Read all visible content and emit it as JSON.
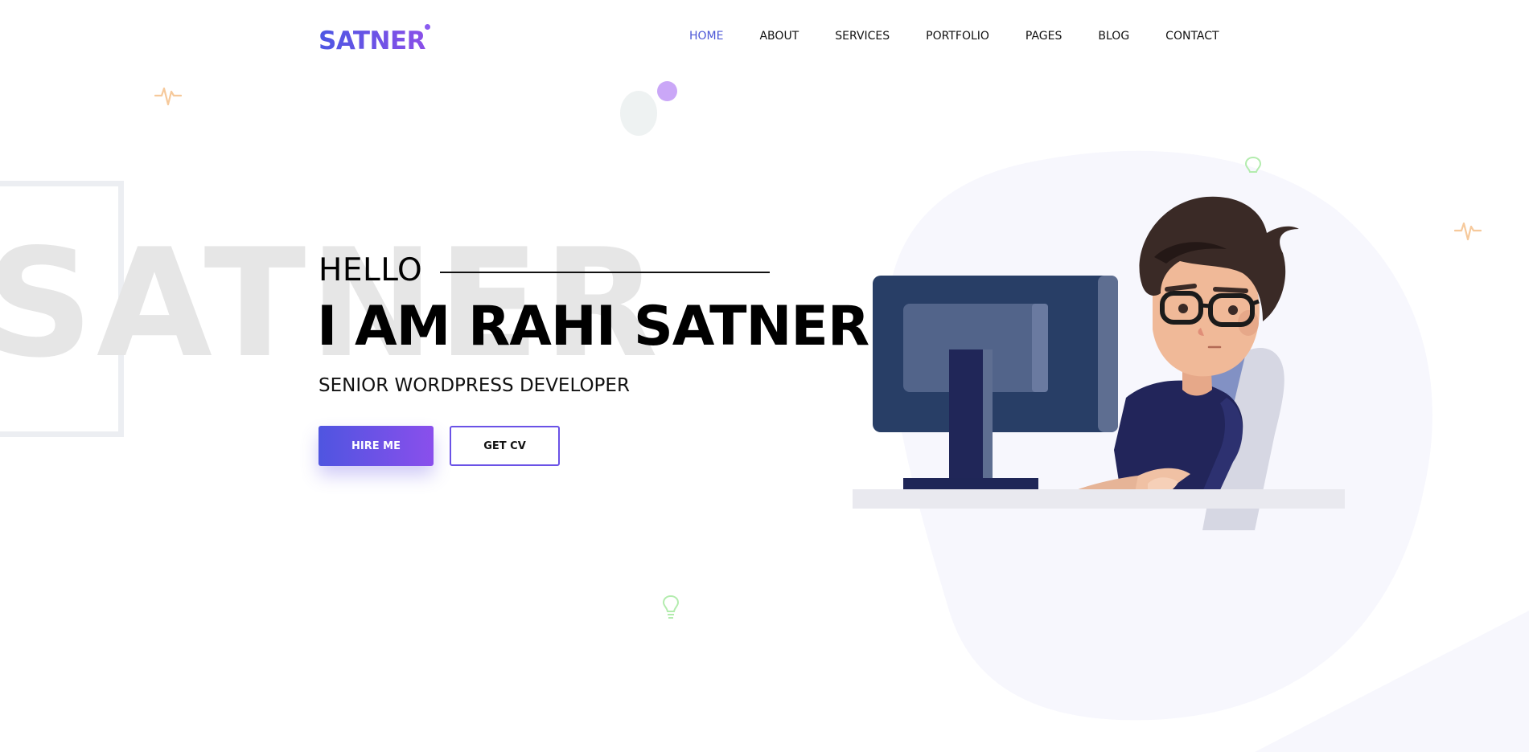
{
  "header": {
    "logo": "SATNER",
    "nav": [
      {
        "label": "HOME",
        "active": true
      },
      {
        "label": "ABOUT",
        "active": false
      },
      {
        "label": "SERVICES",
        "active": false
      },
      {
        "label": "PORTFOLIO",
        "active": false
      },
      {
        "label": "PAGES",
        "active": false
      },
      {
        "label": "BLOG",
        "active": false
      },
      {
        "label": "CONTACT",
        "active": false
      }
    ]
  },
  "hero": {
    "background_word": "SATNER",
    "greeting": "HELLO",
    "name": "I AM RAHI SATNER",
    "role": "SENIOR WORDPRESS DEVELOPER",
    "hire_button": "HIRE ME",
    "cv_button": "GET CV"
  },
  "colors": {
    "accent": "#4b56d6",
    "gradient_start": "#4f55e0",
    "gradient_end": "#8a4fec",
    "blob": "#f7f7fd",
    "text": "#000000"
  },
  "icons": [
    "pulse-icon",
    "lightbulb-icon",
    "circle-dot"
  ]
}
